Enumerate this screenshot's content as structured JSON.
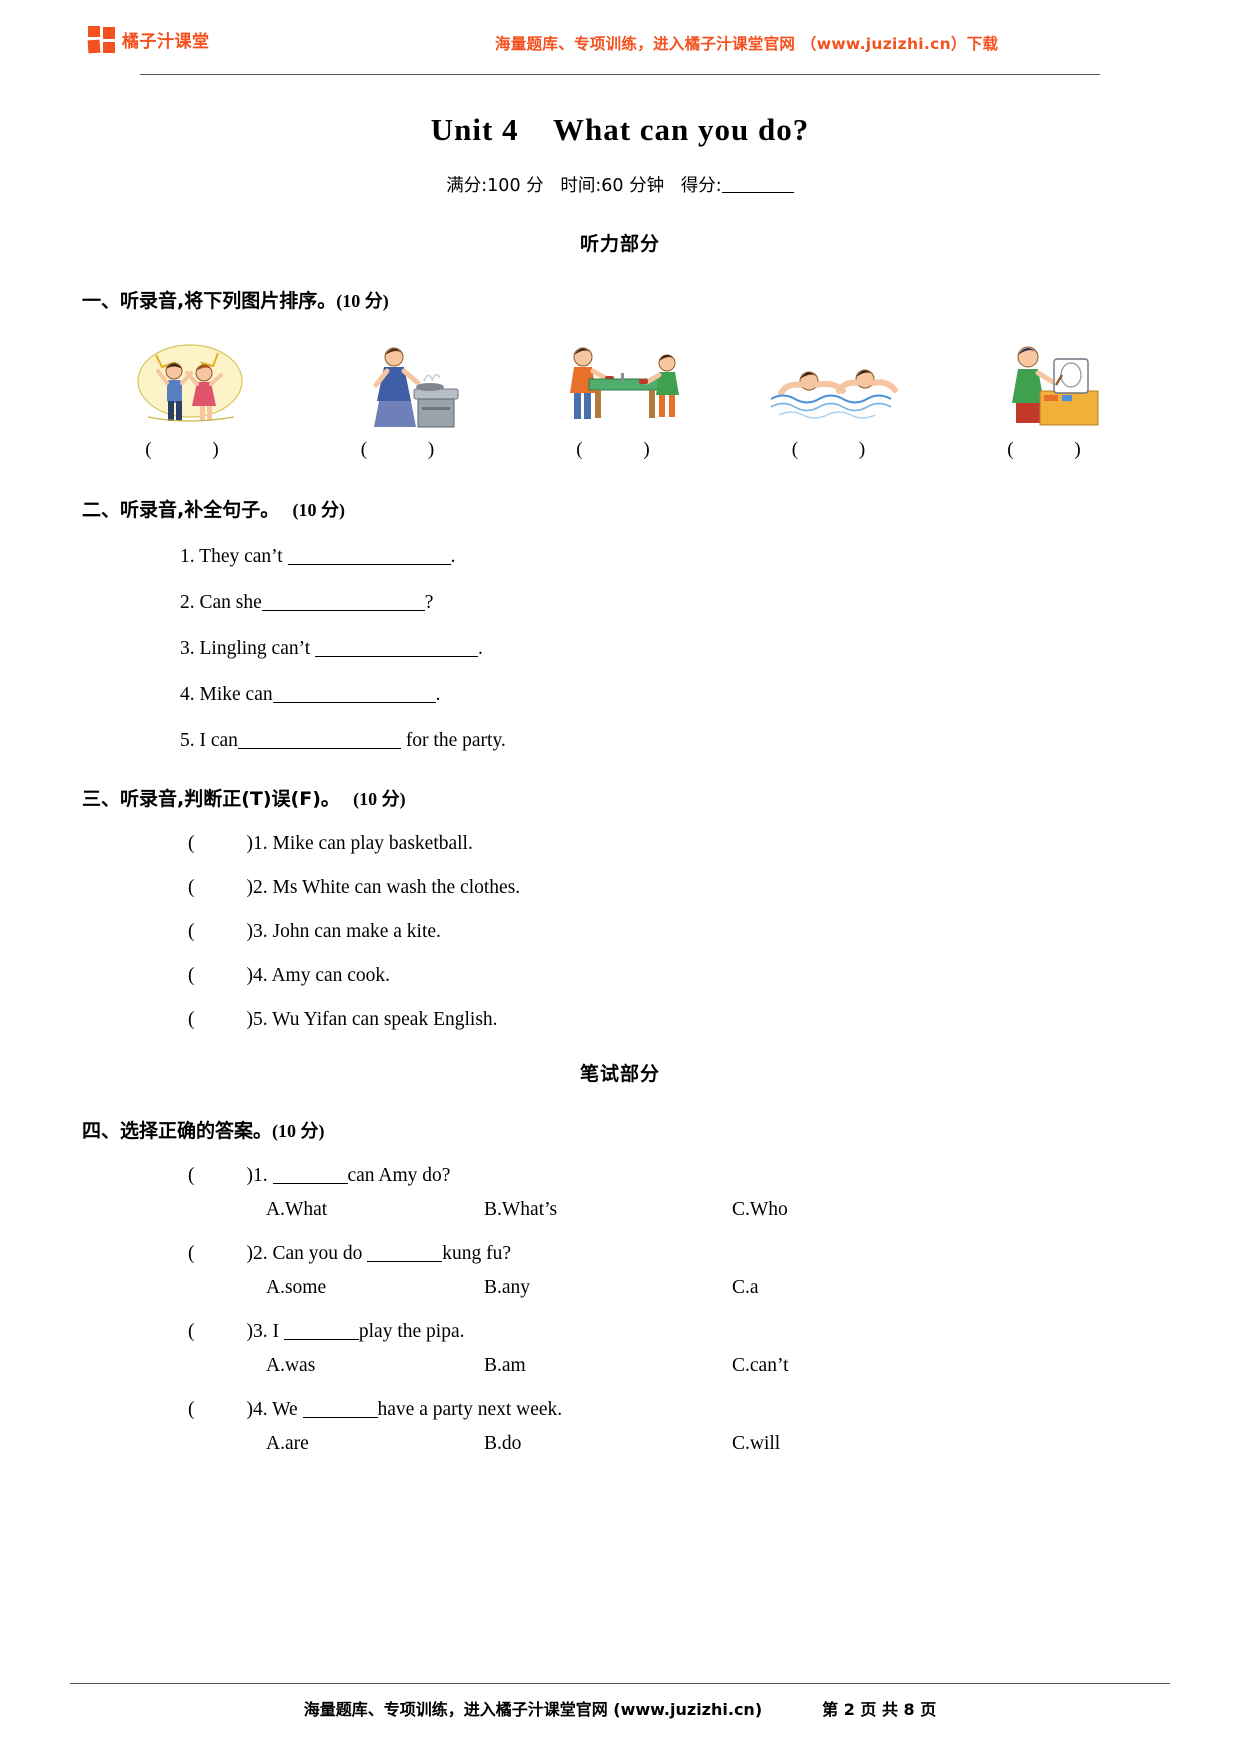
{
  "header": {
    "brand_name": "橘子汁课堂",
    "promo": "海量题库、专项训练，进入橘子汁课堂官网 （www.juzizhi.cn）下载"
  },
  "title": "Unit 4    What can you do?",
  "subtitle_full": "满分:100 分   时间:60 分钟   得分:",
  "subtitle": {
    "full_marks": "满分:100 分",
    "time": "时间:60 分钟",
    "score": "得分:"
  },
  "banners": {
    "listening": "听力部分",
    "written": "笔试部分"
  },
  "sections": [
    {
      "id": "section-one",
      "heading": "一、听录音,将下列图片排序。",
      "points": "(10 分)",
      "type": "picture-ordering",
      "pictures": [
        {
          "name": "dance-party-picture",
          "bracket": "(      )"
        },
        {
          "name": "cooking-picture",
          "bracket": "(      )"
        },
        {
          "name": "ping-pong-picture",
          "bracket": "(      )"
        },
        {
          "name": "swimming-picture",
          "bracket": "(      )"
        },
        {
          "name": "drawing-picture",
          "bracket": "(      )"
        }
      ]
    },
    {
      "id": "section-two",
      "heading": "二、听录音,补全句子。",
      "points": "(10 分)",
      "type": "fill-in-blank",
      "items": [
        {
          "num": "1.",
          "before": "They can’t ",
          "after": "."
        },
        {
          "num": "2.",
          "before": "Can she",
          "after": "?"
        },
        {
          "num": "3.",
          "before": "Lingling can’t ",
          "after": "."
        },
        {
          "num": "4.",
          "before": "Mike can",
          "after": "."
        },
        {
          "num": "5.",
          "before": "I can",
          "after": " for the party."
        }
      ]
    },
    {
      "id": "section-three",
      "heading": "三、听录音,判断正(T)误(F)。",
      "points": "(10 分)",
      "type": "true-false",
      "items": [
        {
          "num": "1.",
          "text": "Mike can play basketball."
        },
        {
          "num": "2.",
          "text": "Ms White can wash the clothes."
        },
        {
          "num": "3.",
          "text": "John can make a kite."
        },
        {
          "num": "4.",
          "text": "Amy can cook."
        },
        {
          "num": "5.",
          "text": "Wu Yifan can speak English."
        }
      ]
    },
    {
      "id": "section-four",
      "heading": "四、选择正确的答案。",
      "points": "(10 分)",
      "type": "multiple-choice",
      "items": [
        {
          "num": "1.",
          "stem_before": " ",
          "stem_after": "can Amy do?",
          "options": [
            "A.What",
            "B.What’s",
            "C.Who"
          ]
        },
        {
          "num": "2.",
          "stem_before": " Can you do ",
          "stem_after": "kung fu?",
          "options": [
            "A.some",
            "B.any",
            "C.a"
          ]
        },
        {
          "num": "3.",
          "stem_before": " I ",
          "stem_after": "play the pipa.",
          "options": [
            "A.was",
            "B.am",
            "C.can’t"
          ]
        },
        {
          "num": "4.",
          "stem_before": " We ",
          "stem_after": "have a party next week.",
          "options": [
            "A.are",
            "B.do",
            "C.will"
          ]
        }
      ]
    }
  ],
  "footer": {
    "promo": "海量题库、专项训练，进入橘子汁课堂官网 (www.juzizhi.cn)",
    "pages": "第 2 页 共 8 页"
  },
  "colors": {
    "brand_orange": "#f4511e",
    "rule_gray": "#555555",
    "text_black": "#000000"
  }
}
